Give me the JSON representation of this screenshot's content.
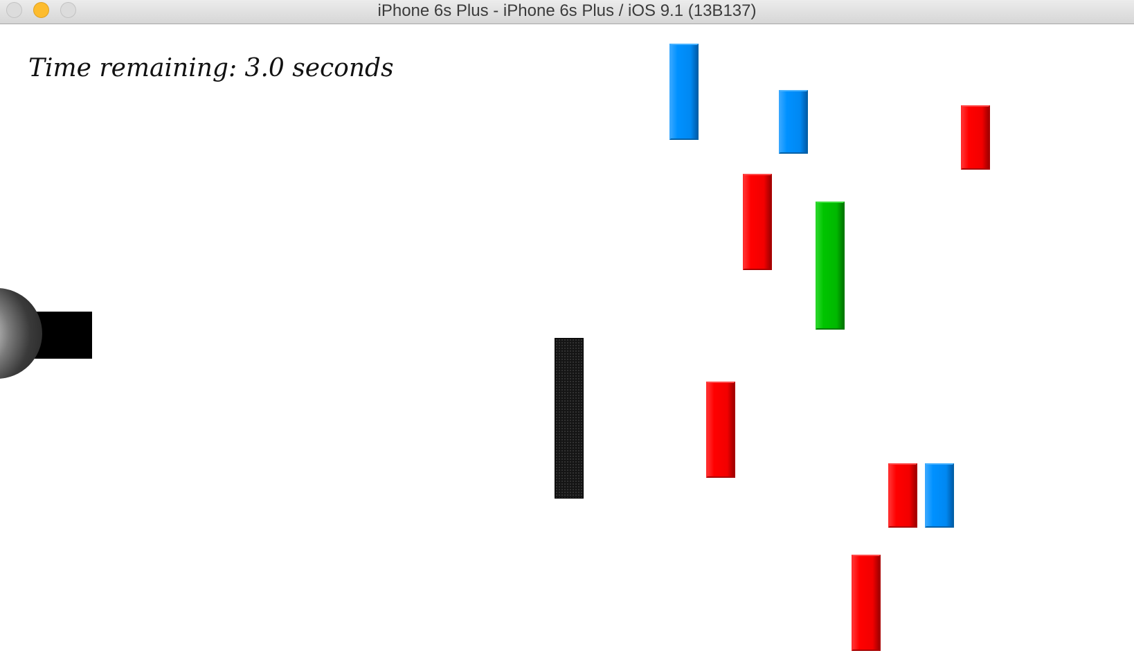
{
  "window": {
    "title": "iPhone 6s Plus - iPhone 6s Plus / iOS 9.1 (13B137)"
  },
  "hud": {
    "timer_text": "Time remaining: 3.0 seconds"
  },
  "colors": {
    "blue_block": "#0091ff",
    "red_block": "#ff0000",
    "green_block": "#00c400",
    "obstacle": "#151515",
    "cannon": "#000000",
    "minimize_button": "#fdbc2e"
  },
  "blocks": [
    {
      "name": "blue-block",
      "color": "blue"
    },
    {
      "name": "blue-block",
      "color": "blue"
    },
    {
      "name": "red-block",
      "color": "red"
    },
    {
      "name": "red-block",
      "color": "red"
    },
    {
      "name": "green-block",
      "color": "green"
    },
    {
      "name": "black-obstacle",
      "color": "black"
    },
    {
      "name": "red-block",
      "color": "red"
    },
    {
      "name": "red-block",
      "color": "red"
    },
    {
      "name": "blue-block",
      "color": "blue"
    },
    {
      "name": "red-block",
      "color": "red"
    }
  ]
}
